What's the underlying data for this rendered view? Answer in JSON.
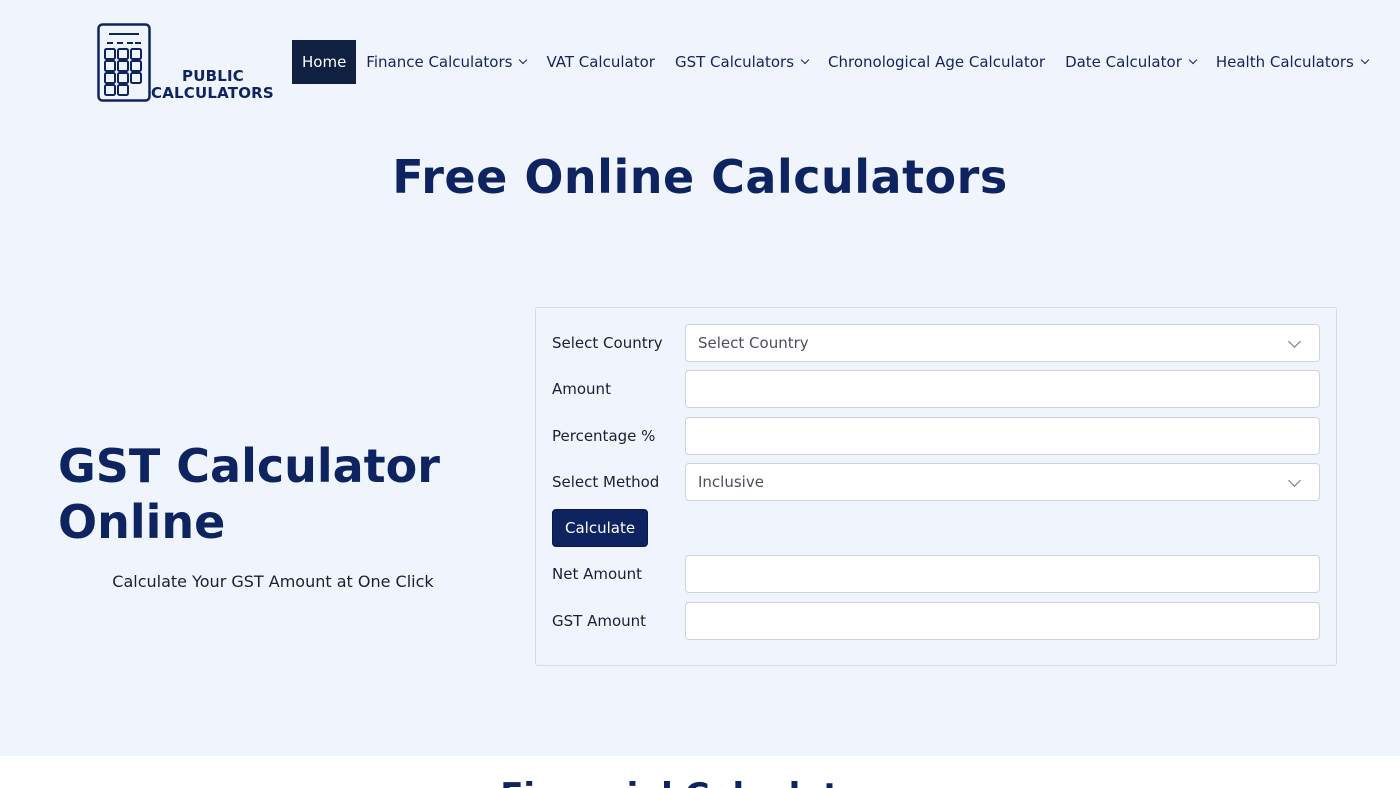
{
  "logo": {
    "line1": "PUBLIC",
    "line2": "CALCULATORS"
  },
  "nav": {
    "items": [
      {
        "label": "Home",
        "active": true,
        "dropdown": false
      },
      {
        "label": "Finance Calculators",
        "dropdown": true
      },
      {
        "label": "VAT Calculator",
        "dropdown": false
      },
      {
        "label": "GST Calculators",
        "dropdown": true
      },
      {
        "label": "Chronological Age Calculator",
        "dropdown": false
      },
      {
        "label": "Date Calculator",
        "dropdown": true
      },
      {
        "label": "Health Calculators",
        "dropdown": true
      }
    ]
  },
  "hero": {
    "title": "Free Online Calculators"
  },
  "intro": {
    "title": "GST Calculator Online",
    "subtitle": "Calculate Your GST Amount at One Click"
  },
  "form": {
    "country": {
      "label": "Select Country",
      "value": "Select Country"
    },
    "amount": {
      "label": "Amount",
      "value": ""
    },
    "percentage": {
      "label": "Percentage %",
      "value": ""
    },
    "method": {
      "label": "Select Method",
      "value": "Inclusive"
    },
    "calculate_label": "Calculate",
    "net_amount": {
      "label": "Net Amount",
      "value": ""
    },
    "gst_amount": {
      "label": "GST Amount",
      "value": ""
    }
  },
  "next_section": {
    "title": "Financial Calculators"
  },
  "colors": {
    "brand": "#0e2461",
    "nav_active": "#0f2040",
    "background": "#f0f5fd"
  }
}
